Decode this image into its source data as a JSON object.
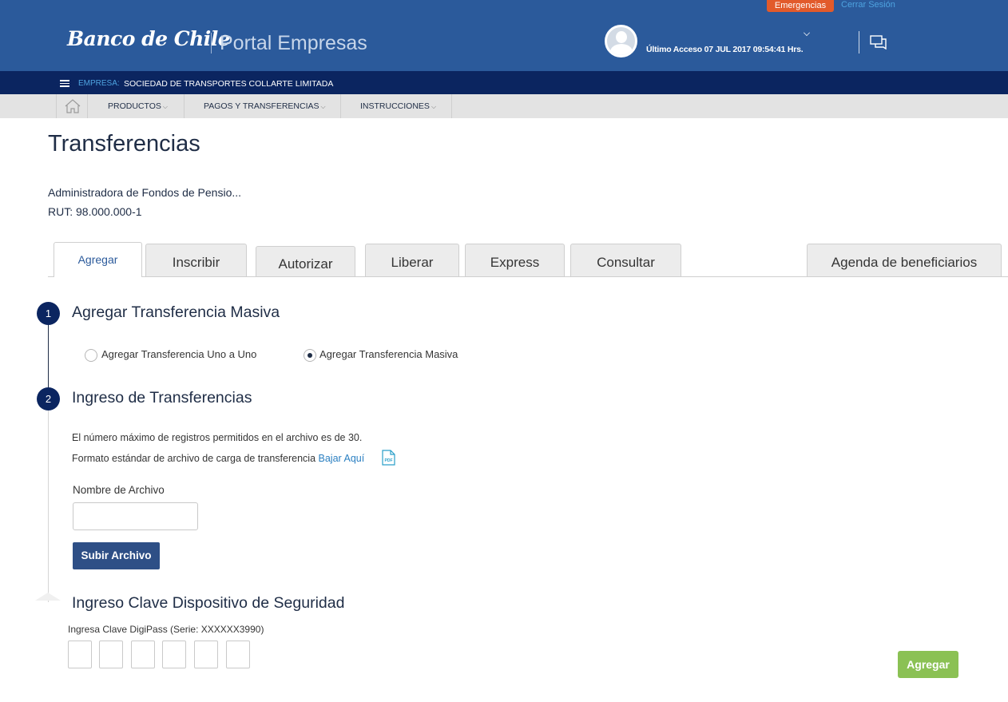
{
  "header": {
    "emergency_label": "Emergencias",
    "logout_label": "Cerrar Sesión",
    "brand": "Banco de Chile",
    "portal": "Portal Empresas",
    "last_access": "Último Acceso 07 JUL 2017 09:54:41 Hrs."
  },
  "company": {
    "label": "EMPRESA:",
    "name": "SOCIEDAD DE TRANSPORTES COLLARTE LIMITADA"
  },
  "nav": {
    "items": [
      "PRODUCTOS",
      "PAGOS Y TRANSFERENCIAS",
      "INSTRUCCIONES"
    ]
  },
  "page": {
    "title": "Transferencias",
    "company_full": "Administradora de Fondos de Pensio...",
    "rut": "RUT: 98.000.000-1"
  },
  "tabs": [
    "Agregar",
    "Inscribir",
    "Autorizar",
    "Liberar",
    "Express",
    "Consultar",
    "Agenda de beneficiarios"
  ],
  "step1": {
    "number": "1",
    "title": "Agregar Transferencia Masiva",
    "options": [
      "Agregar Transferencia Uno a Uno",
      "Agregar Transferencia Masiva"
    ],
    "selected": "Agregar Transferencia Masiva"
  },
  "step2": {
    "number": "2",
    "title": "Ingreso de Transferencias",
    "max_records": "El número máximo de registros permitidos en el archivo es de 30.",
    "format_text": "Formato estándar de archivo de carga de transferencia ",
    "download_link": "Bajar Aquí",
    "file_label": "Nombre de Archivo",
    "file_value": "",
    "upload_label": "Subir Archivo"
  },
  "security": {
    "title": "Ingreso Clave Dispositivo de Seguridad",
    "digipass_label": "Ingresa Clave DigiPass (Serie: XXXXXX3990)"
  },
  "actions": {
    "submit_label": "Agregar"
  },
  "colors": {
    "header_blue": "#2b5a9b",
    "company_bar": "#0b2560",
    "emergency": "#e25a2b",
    "submit_green": "#8bc154",
    "upload_blue": "#2e4f86"
  }
}
